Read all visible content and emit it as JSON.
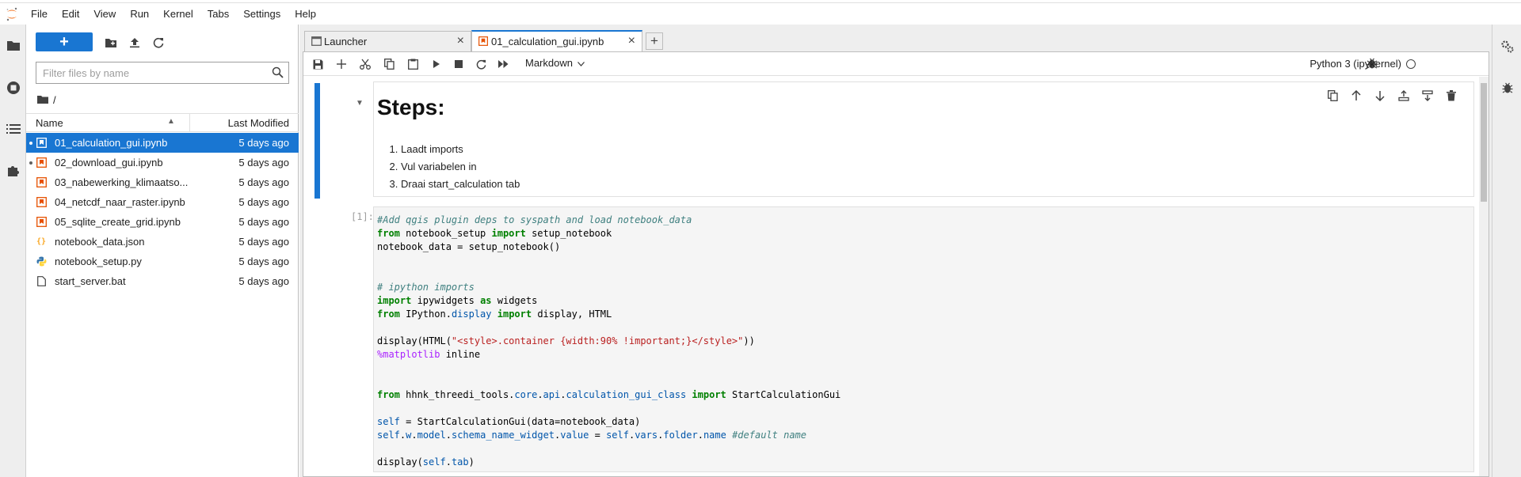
{
  "menu": [
    "File",
    "Edit",
    "View",
    "Run",
    "Kernel",
    "Tabs",
    "Settings",
    "Help"
  ],
  "filebrowser": {
    "new_label": "+",
    "filter_placeholder": "Filter files by name",
    "breadcrumb": "/",
    "col_name": "Name",
    "col_modified": "Last Modified",
    "files": [
      {
        "name": "01_calculation_gui.ipynb",
        "modified": "5 days ago",
        "type": "notebook",
        "running": true,
        "selected": true
      },
      {
        "name": "02_download_gui.ipynb",
        "modified": "5 days ago",
        "type": "notebook",
        "running": true,
        "selected": false
      },
      {
        "name": "03_nabewerking_klimaatso...",
        "modified": "5 days ago",
        "type": "notebook",
        "running": false,
        "selected": false
      },
      {
        "name": "04_netcdf_naar_raster.ipynb",
        "modified": "5 days ago",
        "type": "notebook",
        "running": false,
        "selected": false
      },
      {
        "name": "05_sqlite_create_grid.ipynb",
        "modified": "5 days ago",
        "type": "notebook",
        "running": false,
        "selected": false
      },
      {
        "name": "notebook_data.json",
        "modified": "5 days ago",
        "type": "json",
        "running": false,
        "selected": false
      },
      {
        "name": "notebook_setup.py",
        "modified": "5 days ago",
        "type": "python",
        "running": false,
        "selected": false
      },
      {
        "name": "start_server.bat",
        "modified": "5 days ago",
        "type": "file",
        "running": false,
        "selected": false
      }
    ]
  },
  "tabs": [
    {
      "label": "Launcher",
      "active": false
    },
    {
      "label": "01_calculation_gui.ipynb",
      "active": true
    }
  ],
  "notebook": {
    "cell_type": "Markdown",
    "kernel": "Python 3 (ipykernel)",
    "md_heading": "Steps:",
    "md_steps": [
      "Laadt imports",
      "Vul variabelen in",
      "Draai start_calculation tab"
    ],
    "prompt": "[1]:"
  },
  "colors": {
    "accent": "#1976d2",
    "notebook_icon": "#e65100",
    "json_icon": "#f9a825"
  }
}
